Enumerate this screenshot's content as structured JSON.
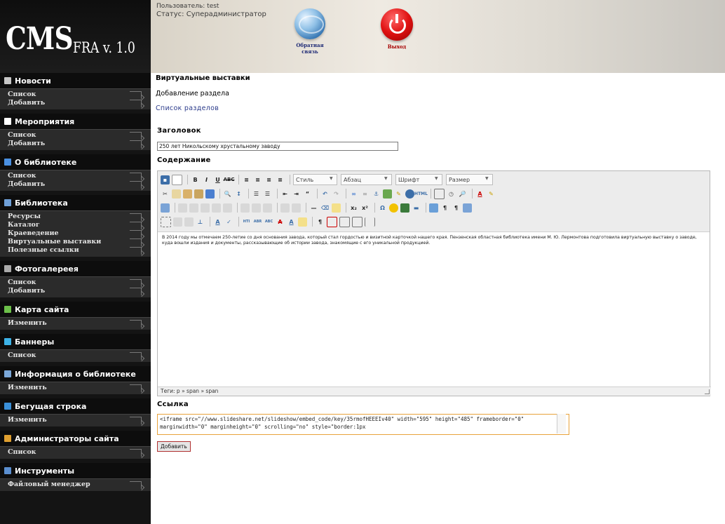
{
  "header": {
    "user": "Пользователь: test",
    "status": "Статус: Суперадминистратор",
    "feedback": "Обратная связь",
    "exit": "Выход"
  },
  "logo": {
    "cms": "CMS",
    "version": "FRA v. 1.0"
  },
  "sidebar": [
    {
      "title": "Новости",
      "icon": "news-icon",
      "color": "#c8c8c8",
      "items": [
        "Список",
        "Добавить"
      ]
    },
    {
      "title": "Мероприятия",
      "icon": "events-icon",
      "color": "#ffffff",
      "items": [
        "Список",
        "Добавить"
      ]
    },
    {
      "title": "О библиотеке",
      "icon": "library-info-icon",
      "color": "#4a90e2",
      "items": [
        "Список",
        "Добавить"
      ]
    },
    {
      "title": "Библиотека",
      "icon": "library-icon",
      "color": "#6fa0d8",
      "items": [
        "Ресурсы",
        "Каталог",
        "Краеведение",
        "Виртуальные выставки",
        "Полезные ссылки"
      ]
    },
    {
      "title": "Фотогалереея",
      "icon": "gallery-icon",
      "color": "#aaaaaa",
      "items": [
        "Список",
        "Добавить"
      ]
    },
    {
      "title": "Карта сайта",
      "icon": "sitemap-icon",
      "color": "#6cc04a",
      "items": [
        "Изменить"
      ]
    },
    {
      "title": "Баннеры",
      "icon": "banners-icon",
      "color": "#3db3e8",
      "items": [
        "Список"
      ]
    },
    {
      "title": "Информация о библиотеке",
      "icon": "library-details-icon",
      "color": "#7aa7d8",
      "items": [
        "Изменить"
      ]
    },
    {
      "title": "Бегущая строка",
      "icon": "ticker-icon",
      "color": "#3a8fd8",
      "items": [
        "Изменить"
      ]
    },
    {
      "title": "Администраторы сайта",
      "icon": "admins-icon",
      "color": "#e0a030",
      "items": [
        "Список"
      ]
    },
    {
      "title": "Инструменты",
      "icon": "tools-icon",
      "color": "#5b8fd0",
      "items": [
        "Файловый менеджер"
      ]
    }
  ],
  "main": {
    "page_title": "Виртуальные выставки",
    "subtitle": "Добавление раздела",
    "link_list": "Список разделов",
    "heading_label": "Заголовок",
    "heading_value": "250 лет Никольскому хрустальному заводу",
    "content_label": "Содержание",
    "editor_dropdowns": [
      "Стиль",
      "Абзац",
      "Шрифт",
      "Размер"
    ],
    "editor_text": "В 2014 году мы отмечаем 250-летие со дня основания завода, который стал гордостью и визитной карточкой нашего края. Пензенская областная библиотека имени М. Ю. Лермонтова подготовила виртуальную выставку о заводе, куда вошли издания и документы, рассказывающие об истории завода, знакомящие с его уникальной продукцией.",
    "status_path": "Теги: p » span » span",
    "link_label": "Ссылка",
    "link_value": "<iframe src=\"//www.slideshare.net/slideshow/embed_code/key/35rmofHEEEIv40\" width=\"595\" height=\"485\" frameborder=\"0\" marginwidth=\"0\" marginheight=\"0\" scrolling=\"no\" style=\"border:1px",
    "add_button": "Добавить"
  }
}
